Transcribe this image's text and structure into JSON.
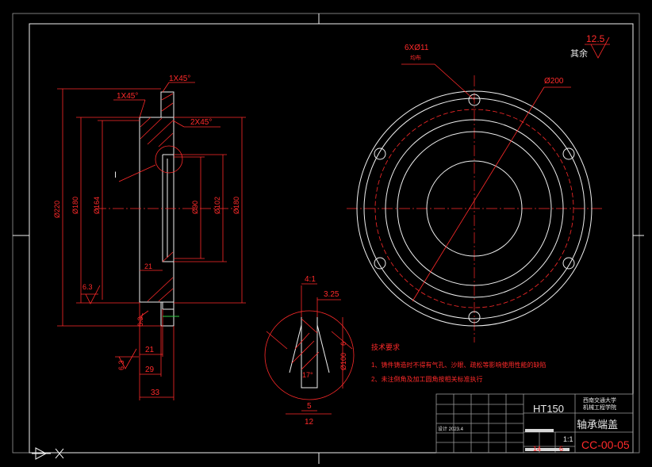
{
  "frame_mark": "◁",
  "surface_roughness_note": {
    "value": "12.5",
    "label": "其余"
  },
  "hole_callout": {
    "spec": "6XØ11",
    "sub": "均布"
  },
  "bolt_circle_dia": "Ø200",
  "chamfers": [
    "1X45°",
    "1X45°",
    "2X45°"
  ],
  "section_label": "I",
  "diameters_left": [
    "Ø220",
    "Ø180",
    "Ø164"
  ],
  "diameters_right": [
    "Ø90",
    "Ø102",
    "Ø180"
  ],
  "dims_bottom": [
    "21",
    "21",
    "29",
    "33"
  ],
  "roughness_left": [
    "6.3",
    "6.3",
    "6.3"
  ],
  "detail": {
    "top": [
      "4:1",
      "3.25"
    ],
    "side": [
      "6",
      "Ø100"
    ],
    "angle": "17°",
    "bottom": [
      "5",
      "12"
    ]
  },
  "tech_requirements": {
    "title": "技术要求",
    "items": [
      "1、铸件铸造时不得有气孔、沙眼、疏松等影响使用性能的缺陷",
      "2、未注倒角及加工圆角按相关标准执行"
    ]
  },
  "title_block": {
    "material": "HT150",
    "school_line1": "西南交通大学",
    "school_line2": "机械工程学院",
    "part_name": "轴承端盖",
    "scale": "1:1",
    "sheet_a": "14",
    "sheet_b": "6",
    "drawing_no": "CC-00-05",
    "small_label": "设计 2023.4"
  }
}
